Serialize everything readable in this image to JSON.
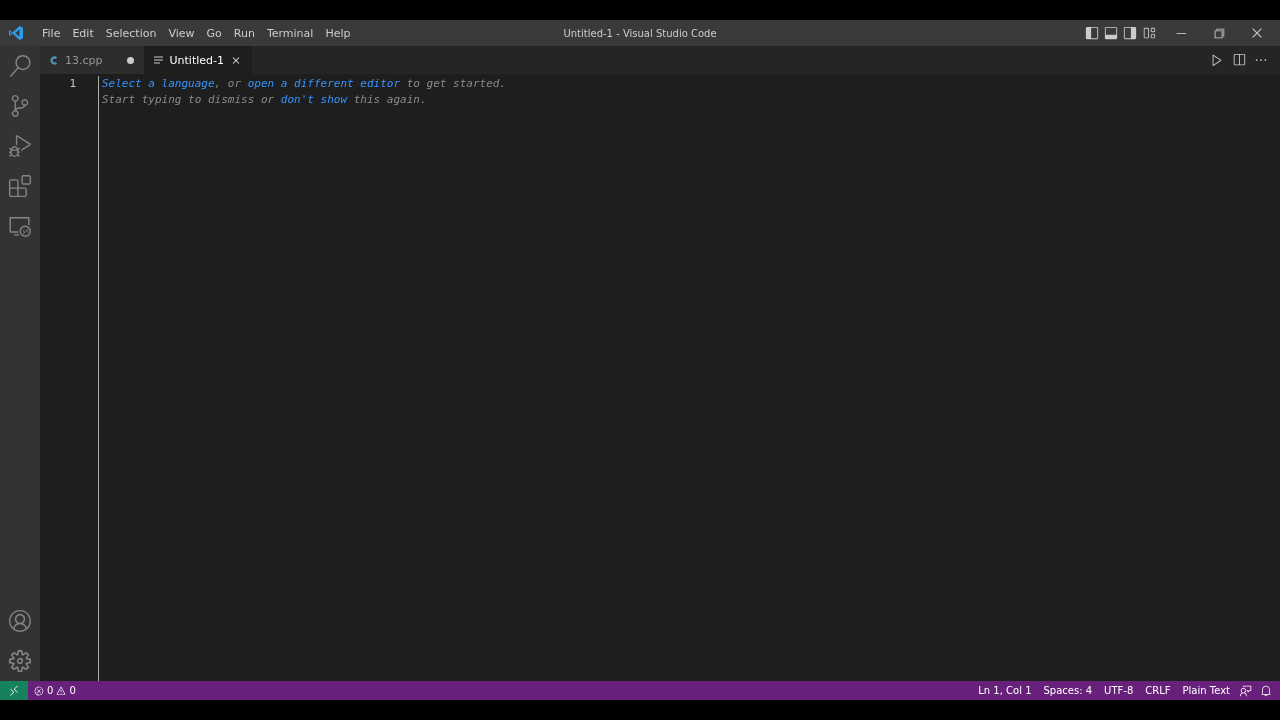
{
  "window": {
    "title": "Untitled-1 - Visual Studio Code"
  },
  "menu": [
    "File",
    "Edit",
    "Selection",
    "View",
    "Go",
    "Run",
    "Terminal",
    "Help"
  ],
  "activity_bar": {
    "top": [
      {
        "kind": "search"
      },
      {
        "kind": "source-control"
      },
      {
        "kind": "run-debug"
      },
      {
        "kind": "extensions"
      },
      {
        "kind": "remote-explorer"
      }
    ],
    "bottom": [
      {
        "kind": "accounts"
      },
      {
        "kind": "settings"
      }
    ]
  },
  "tabs": [
    {
      "label": "13.cpp",
      "kind": "cpp",
      "selected": false,
      "dirty": true
    },
    {
      "label": "Untitled-1",
      "kind": "text",
      "selected": true,
      "dirty": false
    }
  ],
  "editor": {
    "line_number": "1",
    "hint_lines": [
      [
        {
          "text": "Select a language",
          "link": true
        },
        {
          "text": ", or ",
          "link": false
        },
        {
          "text": "open a different editor",
          "link": true
        },
        {
          "text": " to get started.",
          "link": false
        }
      ],
      [
        {
          "text": "Start typing to dismiss or ",
          "link": false
        },
        {
          "text": "don't show",
          "link": true
        },
        {
          "text": " this again.",
          "link": false
        }
      ]
    ]
  },
  "status_bar": {
    "problems": {
      "errors": "0",
      "warnings": "0"
    },
    "items": [
      "Ln 1, Col 1",
      "Spaces: 4",
      "UTF-8",
      "CRLF",
      "Plain Text"
    ]
  }
}
